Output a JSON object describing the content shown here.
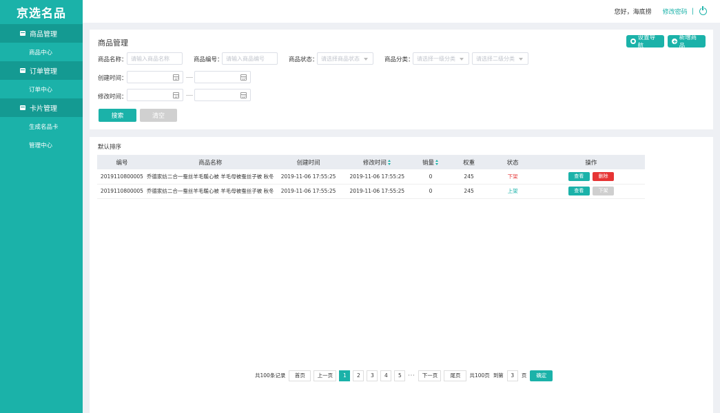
{
  "sidebar": {
    "logo": "京选名品",
    "groups": [
      {
        "label": "商品管理",
        "items": [
          {
            "label": "商品中心"
          }
        ]
      },
      {
        "label": "订单管理",
        "items": [
          {
            "label": "订单中心"
          }
        ]
      },
      {
        "label": "卡片管理",
        "items": [
          {
            "label": "生成名品卡"
          },
          {
            "label": "管理中心"
          }
        ]
      }
    ]
  },
  "header": {
    "greeting": "您好，海底捞",
    "change_password": "修改密码",
    "separator": "|"
  },
  "filter": {
    "title": "商品管理",
    "nav_settings_label": "设置导航",
    "add_product_label": "新增商品",
    "name_label": "商品名称：",
    "name_placeholder": "请输入商品名称",
    "code_label": "商品编号：",
    "code_placeholder": "请输入商品编号",
    "status_label": "商品状态：",
    "status_placeholder": "请选择商品状态",
    "category_label": "商品分类：",
    "category1_placeholder": "请选择一级分类",
    "category2_placeholder": "请选择二级分类",
    "created_label": "创建时间：",
    "modified_label": "修改时间：",
    "search_label": "搜索",
    "clear_label": "清空"
  },
  "list": {
    "sort_label": "默认排序",
    "columns": [
      "编号",
      "商品名称",
      "创建时间",
      "修改时间",
      "销量",
      "权重",
      "状态",
      "操作"
    ],
    "rows": [
      {
        "id": "2019110800005",
        "name": "乔德家纺二合一蚕丝羊毛暖心被 羊毛母被蚕丝子被 秋冬",
        "created": "2019-11-06 17:55:25",
        "modified": "2019-11-06 17:55:25",
        "sales": "0",
        "weight": "245",
        "status": "下架",
        "view": "查看",
        "action": "删除"
      },
      {
        "id": "2019110800005",
        "name": "乔德家纺二合一蚕丝羊毛暖心被 羊毛母被蚕丝子被 秋冬",
        "created": "2019-11-06 17:55:25",
        "modified": "2019-11-06 17:55:25",
        "sales": "0",
        "weight": "245",
        "status": "上架",
        "view": "查看",
        "action": "下架"
      }
    ]
  },
  "pagination": {
    "total_records": "共100条记录",
    "first": "首页",
    "prev": "上一页",
    "pages": [
      "1",
      "2",
      "3",
      "4",
      "5"
    ],
    "current": "1",
    "ellipsis": "···",
    "next": "下一页",
    "last": "尾页",
    "total_pages": "共100页",
    "goto_label": "到第",
    "goto_value": "3",
    "page_unit": "页",
    "confirm": "确定"
  },
  "colors": {
    "accent": "#1bb2a9",
    "sidebar_group": "#149a92",
    "danger": "#e63434"
  }
}
